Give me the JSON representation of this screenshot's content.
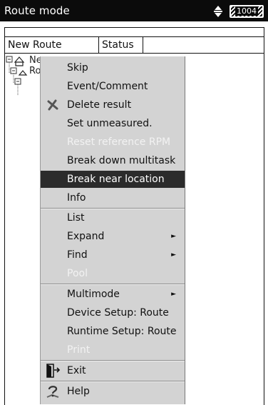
{
  "titlebar": {
    "title": "Route mode",
    "battery_label": "1004"
  },
  "table": {
    "headers": [
      "New Route",
      "Status",
      ""
    ]
  },
  "tree": {
    "root_label": "New Rout"
  },
  "context_menu": {
    "items": [
      {
        "label": "Skip",
        "enabled": true
      },
      {
        "label": "Event/Comment",
        "enabled": true
      },
      {
        "label": "Delete result",
        "enabled": true,
        "icon": "delete-x-icon"
      },
      {
        "label": "Set unmeasured.",
        "enabled": true
      },
      {
        "label": "Reset reference RPM",
        "enabled": false
      },
      {
        "label": "Break down multitask",
        "enabled": true
      },
      {
        "label": "Break near location",
        "enabled": true,
        "selected": true
      },
      {
        "label": "Info",
        "enabled": true
      },
      {
        "label": "List",
        "enabled": true
      },
      {
        "label": "Expand",
        "enabled": true,
        "submenu": true
      },
      {
        "label": "Find",
        "enabled": true,
        "submenu": true
      },
      {
        "label": "Pool",
        "enabled": false
      },
      {
        "label": "Multimode",
        "enabled": true,
        "submenu": true
      },
      {
        "label": "Device Setup: Route",
        "enabled": true
      },
      {
        "label": "Runtime Setup: Route",
        "enabled": true
      },
      {
        "label": "Print",
        "enabled": false
      },
      {
        "label": "Exit",
        "enabled": true,
        "icon": "exit-door-icon"
      },
      {
        "label": "Help",
        "enabled": true,
        "icon": "help-question-icon"
      }
    ],
    "submenu_glyph": "►"
  },
  "colors": {
    "titlebar_bg": "#0b0b0b",
    "menu_bg": "#d3d3d3",
    "selected_bg": "#2b2b2b",
    "disabled_text": "#f2f2f2"
  }
}
